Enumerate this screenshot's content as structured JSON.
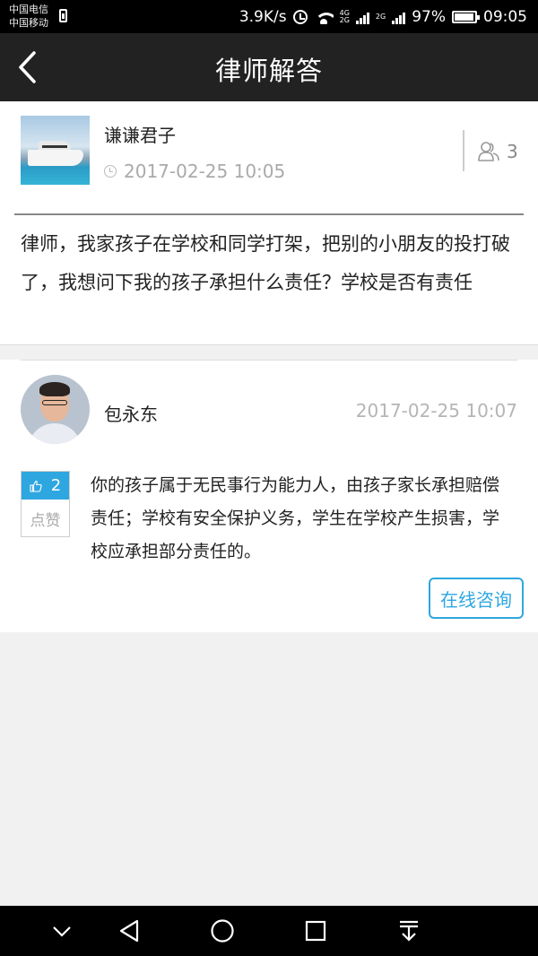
{
  "status_bar": {
    "carrier_1": "中国电信",
    "carrier_2": "中国移动",
    "net_speed": "3.9K/s",
    "net_4g": "4G",
    "net_4g_sub": "2G",
    "net_2g": "2G",
    "battery": "97%",
    "battery_level": 0.97,
    "time": "09:05"
  },
  "app_bar": {
    "title": "律师解答"
  },
  "question": {
    "username": "谦谦君子",
    "time": "2017-02-25 10:05",
    "viewer_count": "3",
    "text": "律师，我家孩子在学校和同学打架，把别的小朋友的投打破了，我想问下我的孩子承担什么责任？学校是否有责任"
  },
  "answer": {
    "lawyer_name": "包永东",
    "time": "2017-02-25 10:07",
    "like_count": "2",
    "like_label": "点赞",
    "text": "你的孩子属于无民事行为能力人，由孩子家长承担赔偿责任；学校有安全保护义务，学生在学校产生损害，学校应承担部分责任的。",
    "consult_label": "在线咨询"
  },
  "colors": {
    "accent": "#2ea7e0",
    "app_bar": "#222222",
    "status_bar": "#000000"
  }
}
